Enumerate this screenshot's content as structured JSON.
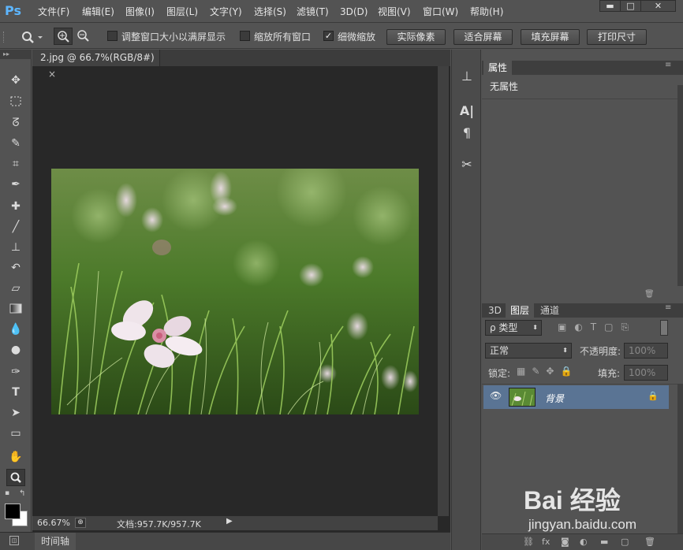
{
  "app": {
    "logo": "Ps"
  },
  "menu": [
    "文件(F)",
    "编辑(E)",
    "图像(I)",
    "图层(L)",
    "文字(Y)",
    "选择(S)",
    "滤镜(T)",
    "3D(D)",
    "视图(V)",
    "窗口(W)",
    "帮助(H)"
  ],
  "window_controls": {
    "minimize": "▬",
    "maximize": "□",
    "close": "✕"
  },
  "options": {
    "checkbox1_label": "调整窗口大小以满屏显示",
    "checkbox1_checked": false,
    "checkbox2_label": "缩放所有窗口",
    "checkbox2_checked": false,
    "checkbox3_label": "细微缩放",
    "checkbox3_checked": true,
    "btn_actual_pixels": "实际像素",
    "btn_fit_screen": "适合屏幕",
    "btn_fill_screen": "填充屏幕",
    "btn_print_size": "打印尺寸"
  },
  "document": {
    "tab_title": "2.jpg @ 66.7%(RGB/8#)",
    "tab_close": "×",
    "zoom": "66.67%",
    "doc_info": "文档:957.7K/957.7K"
  },
  "timeline": {
    "label": "时间轴"
  },
  "properties": {
    "tab": "属性",
    "content": "无属性"
  },
  "layers": {
    "tabs": [
      "3D",
      "图层",
      "通道"
    ],
    "filter_kind": "ρ 类型",
    "blend_mode": "正常",
    "opacity_label": "不透明度:",
    "opacity_value": "100%",
    "lock_label": "锁定:",
    "fill_label": "填充:",
    "fill_value": "100%",
    "layer_name": "背景"
  },
  "watermark": {
    "brand": "Bai 经验",
    "url": "jingyan.baidu.com"
  }
}
